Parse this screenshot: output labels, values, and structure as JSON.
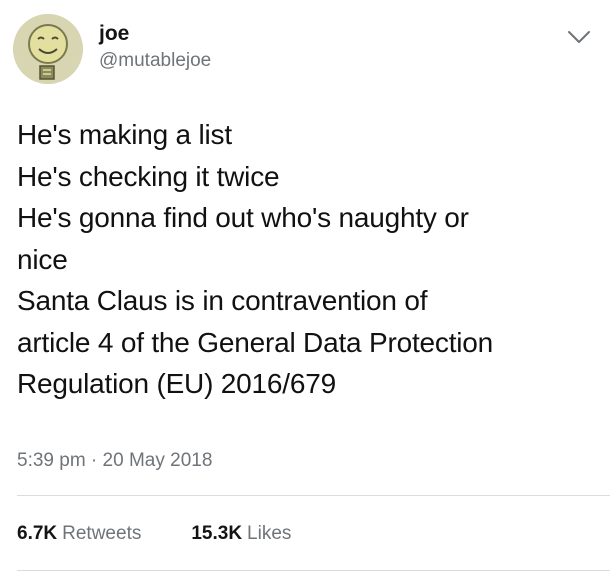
{
  "author": {
    "display_name": "joe",
    "handle": "@mutablejoe",
    "avatar_icon": "smiley-face-avatar",
    "avatar_color": "#d8d5b2"
  },
  "menu": {
    "icon": "chevron-down-icon"
  },
  "tweet": {
    "lines": [
      "He's making a list",
      "He's checking it twice",
      "He's gonna find out who's naughty or",
      "nice",
      "Santa Claus is in contravention of",
      "article 4 of the General Data Protection",
      "Regulation (EU) 2016/679"
    ]
  },
  "meta": {
    "timestamp": "5:39 pm · 20 May 2018"
  },
  "stats": {
    "retweets_count": "6.7K",
    "retweets_label": "Retweets",
    "likes_count": "15.3K",
    "likes_label": "Likes"
  },
  "colors": {
    "text": "#141414",
    "secondary": "#6f7479",
    "divider": "#d9dde1"
  }
}
